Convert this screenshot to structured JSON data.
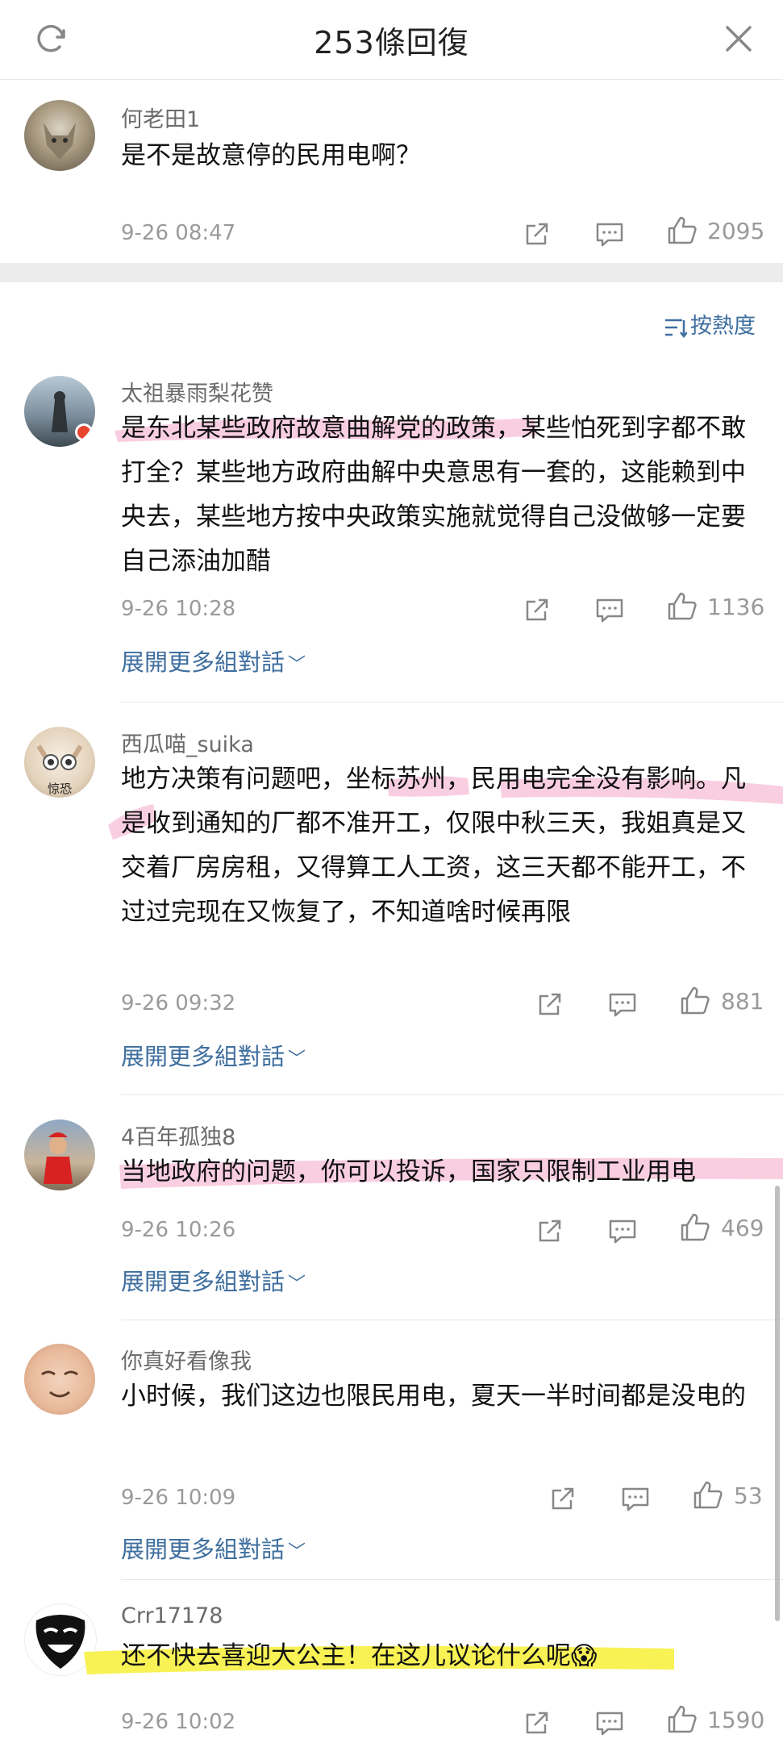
{
  "header": {
    "title": "253條回復"
  },
  "top_comment": {
    "username": "何老田1",
    "text": "是不是故意停的民用电啊？",
    "time": "9-26 08:47",
    "likes": "2095"
  },
  "sort_label": "按熱度",
  "expand_label": "展開更多組對話",
  "comments": [
    {
      "username": "太祖暴雨梨花赞",
      "text": "是东北某些政府故意曲解党的政策，某些怕死到字都不敢打全？某些地方政府曲解中央意思有一套的，这能赖到中央去，某些地方按中央政策实施就觉得自己没做够一定要自己添油加醋",
      "time": "9-26 10:28",
      "likes": "1136"
    },
    {
      "username": "西瓜喵_suika",
      "text": "地方决策有问题吧，坐标苏州，民用电完全没有影响。凡是收到通知的厂都不准开工，仅限中秋三天，我姐真是又交着厂房房租，又得算工人工资，这三天都不能开工，不过过完现在又恢复了，不知道啥时候再限",
      "time": "9-26 09:32",
      "likes": "881",
      "avatar_text": "惊恐"
    },
    {
      "username": "4百年孤独8",
      "text": "当地政府的问题，你可以投诉，国家只限制工业用电",
      "time": "9-26 10:26",
      "likes": "469"
    },
    {
      "username": "你真好看像我",
      "text": "小时候，我们这边也限民用电，夏天一半时间都是没电的",
      "time": "9-26 10:09",
      "likes": "53"
    },
    {
      "username": "Crr17178",
      "text": "还不快去喜迎大公主！在这儿议论什么呢😱",
      "time": "9-26 10:02",
      "likes": "1590"
    }
  ],
  "colors": {
    "link": "#3f6f9f",
    "pink_highlight": "#f4a6c8",
    "yellow_highlight": "#f5ee1c"
  },
  "icons": [
    "refresh-icon",
    "close-icon",
    "share-icon",
    "comment-icon",
    "like-icon",
    "sort-icon",
    "chevron-down-icon"
  ]
}
